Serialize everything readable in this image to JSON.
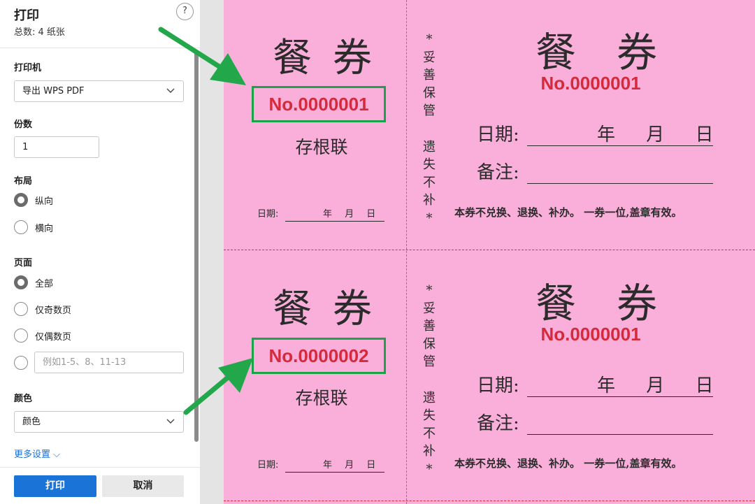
{
  "dialog": {
    "title": "打印",
    "subtitle": "总数: 4 纸张",
    "help_label": "?"
  },
  "printer": {
    "label": "打印机",
    "value": "导出 WPS PDF"
  },
  "copies": {
    "label": "份数",
    "value": "1"
  },
  "layout": {
    "label": "布局",
    "options": [
      {
        "label": "纵向",
        "selected": true
      },
      {
        "label": "横向",
        "selected": false
      }
    ]
  },
  "pages": {
    "label": "页面",
    "options": [
      {
        "label": "全部",
        "selected": true
      },
      {
        "label": "仅奇数页",
        "selected": false
      },
      {
        "label": "仅偶数页",
        "selected": false
      }
    ],
    "custom_placeholder": "例如1-5、8、11-13"
  },
  "color": {
    "label": "颜色",
    "value": "颜色"
  },
  "more_settings": "更多设置 ⌵",
  "buttons": {
    "print": "打印",
    "cancel": "取消"
  },
  "colors": {
    "accent": "#1a73d6",
    "paper": "#f9afd9",
    "ticket_number": "#d42a3c",
    "highlight_green": "#1ba34a"
  },
  "tickets": [
    {
      "stub_title": "餐券",
      "stub_number": "No.0000001",
      "stub_label": "存根联",
      "stub_date_label": "日期:",
      "stub_ymd": "年 月 日",
      "vertical_note": "*\n妥\n善\n保\n管\n \n遗\n失\n不\n补\n*",
      "main_title": "餐券",
      "main_number": "No.0000001",
      "date_label": "日期:",
      "date_ymd": "年 月 日",
      "remark_label": "备注:",
      "notice": "本券不兑换、退换、补办。 一券一位,盖章有效。"
    },
    {
      "stub_title": "餐券",
      "stub_number": "No.0000002",
      "stub_label": "存根联",
      "stub_date_label": "日期:",
      "stub_ymd": "年 月 日",
      "vertical_note": "*\n妥\n善\n保\n管\n \n遗\n失\n不\n补\n*",
      "main_title": "餐券",
      "main_number": "No.0000001",
      "date_label": "日期:",
      "date_ymd": "年 月 日",
      "remark_label": "备注:",
      "notice": "本券不兑换、退换、补办。 一券一位,盖章有效。"
    }
  ]
}
